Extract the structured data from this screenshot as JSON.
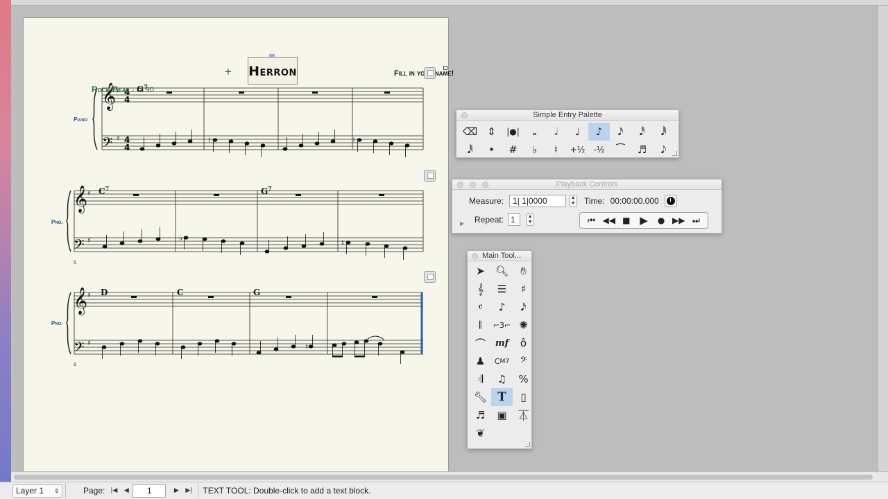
{
  "score": {
    "title": "Herron",
    "fill_name": "Fill in your name!",
    "tempo_text": "Rock Beat",
    "tempo_value": "= 90",
    "tempo_note": "♩",
    "instrument_full": "Piano",
    "instrument_short_2": "Pno.",
    "instrument_short_3": "Pno.",
    "measure_num_2": "5",
    "measure_num_3": "9",
    "chords": [
      {
        "root": "G",
        "ext": "7"
      },
      {
        "root": "C",
        "ext": "7"
      },
      {
        "root": "G",
        "ext": "7"
      },
      {
        "root": "D",
        "ext": ""
      },
      {
        "root": "C",
        "ext": ""
      },
      {
        "root": "G",
        "ext": ""
      }
    ]
  },
  "simple_entry": {
    "title": "Simple Entry Palette",
    "row1": [
      "eraser-icon",
      "tie-toggle-icon",
      "chord-entry-icon",
      "whole-note-icon",
      "half-note-icon",
      "quarter-note-icon",
      "eighth-note-icon",
      "sixteenth-note-icon",
      "thirtysecond-note-icon",
      "sixtyfourth-note-icon"
    ],
    "row2_labels": [
      "𝅘𝅥𝅱",
      "•",
      "#",
      "♭",
      "♮",
      "+½",
      "-½",
      "⁀",
      "♬",
      "𝅘𝅥𝅮"
    ]
  },
  "playback": {
    "title": "Playback Controls",
    "measure_label": "Measure:",
    "measure_value": "1| 1|0000",
    "time_label": "Time:",
    "time_value": "00:00:00.000",
    "repeat_label": "Repeat:",
    "repeat_value": "1",
    "transport": [
      "⏮",
      "◀◀",
      "■",
      "▶",
      "●",
      "▶▶",
      "⏭"
    ]
  },
  "main_tool": {
    "title": "Main Tool...",
    "selected": "text-tool"
  },
  "status_bar": {
    "layer": "Layer 1",
    "page_label": "Page:",
    "page_value": "1",
    "message": "TEXT TOOL: Double-click to add a text block."
  }
}
